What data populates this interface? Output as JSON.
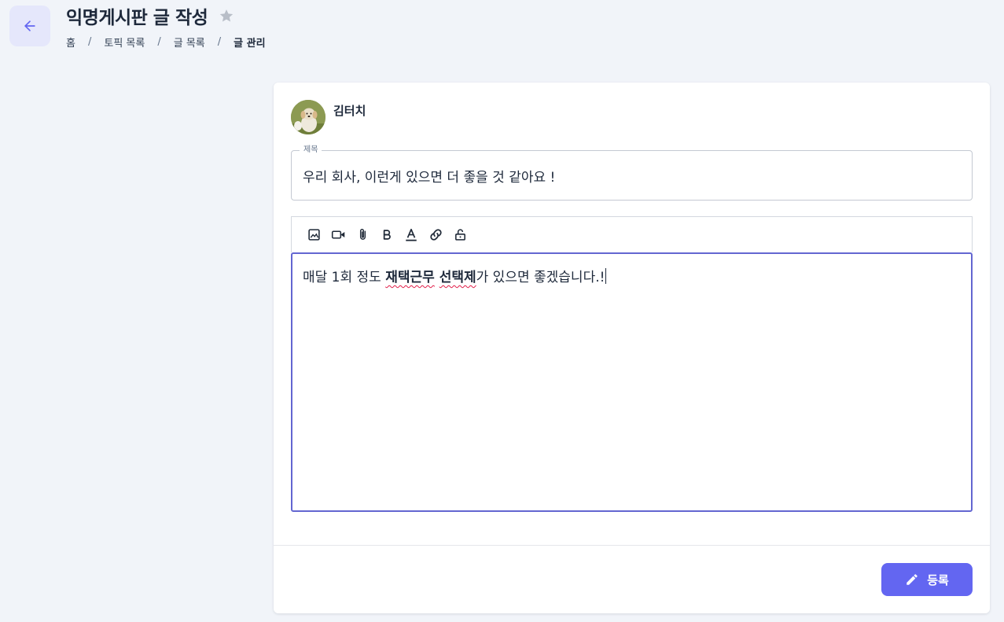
{
  "header": {
    "title": "익명게시판 글 작성",
    "breadcrumb": [
      "홈",
      "토픽 목록",
      "글 목록",
      "글 관리"
    ],
    "separator": "/"
  },
  "post": {
    "author": "김터치",
    "title_label": "제목",
    "title_value": "우리 회사, 이런게 있으면 더 좋을 것 같아요 !",
    "body": {
      "part1": "매달 1회 정도 ",
      "bold_word1": "재택근무",
      "space": " ",
      "bold_word2": "선택제",
      "part2": "가 있으면 좋겠습니다.!"
    }
  },
  "toolbar": {
    "items": [
      "image-icon",
      "video-icon",
      "attach-icon",
      "bold-icon",
      "text-color-icon",
      "link-icon",
      "lock-icon"
    ]
  },
  "actions": {
    "submit_label": "등록"
  },
  "colors": {
    "accent": "#6366f1",
    "editor_border": "#6366d1",
    "background": "#f1f4f9"
  }
}
